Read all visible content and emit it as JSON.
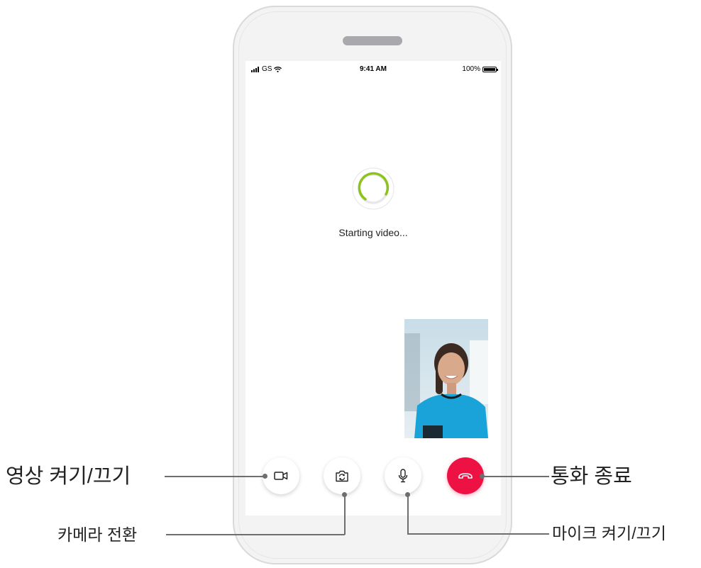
{
  "status_bar": {
    "carrier": "GS",
    "time": "9:41 AM",
    "battery": "100%"
  },
  "call": {
    "status_text": "Starting video...",
    "spinner_color": "#8dc21f"
  },
  "controls": {
    "video_icon": "video-camera-icon",
    "switch_icon": "camera-switch-icon",
    "mic_icon": "microphone-icon",
    "end_icon": "hang-up-icon",
    "end_color": "#ee1144"
  },
  "callouts": {
    "video_toggle": "영상 켜기/끄기",
    "camera_switch": "카메라 전환",
    "mic_toggle": "마이크 켜기/끄기",
    "end_call": "통화 종료"
  }
}
